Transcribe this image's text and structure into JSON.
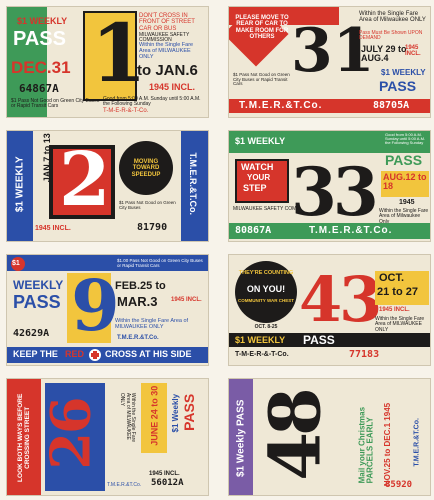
{
  "colors": {
    "red": "#d6352b",
    "yellow": "#f2c53d",
    "blue": "#2b4fa8",
    "green": "#3e9a58",
    "black": "#1d1b1a",
    "orange": "#e07a2f",
    "purple": "#7a5ca6",
    "cream": "#efe8d6",
    "teal": "#2f8f8a"
  },
  "passes": [
    {
      "number": "1",
      "kicker": "$1 WEEKLY",
      "title": "PASS",
      "warn": "DON'T CROSS IN FRONT OF STREET CAR OR BUS",
      "safety": "MILWAUKEE SAFETY COMMISSION",
      "area": "Within the Single Fare Area of MILWAUKEE ONLY",
      "from": "DEC.31",
      "to": "to JAN.6",
      "year": "1945 INCL.",
      "serial": "64867A",
      "note": "$1 Pass Not Good on Green City Buses or Rapid Transit Cars",
      "good": "Good from 5:00 A.M. Sunday until 5:00 A.M. the Following Sunday",
      "company": "T-M-E-R-&-T-Co."
    },
    {
      "number": "31",
      "banner": "PLEASE MOVE TO REAR OF CAR TO MAKE ROOM FOR OTHERS",
      "area": "Within the Single Fare Area of Milwaukee ONLY",
      "demand": "Pass Must Be Shown UPON DEMAND",
      "dates": "JULY 29 to AUG.4",
      "year": "1945 INCL.",
      "kicker": "$1 WEEKLY",
      "title": "PASS",
      "company": "T.M.E.R.&T.Co.",
      "serial": "88705A",
      "note": "$1 Pass Not Good on Green City Buses or Rapid Transit Cars"
    },
    {
      "number": "2",
      "dates": "JAN.7 to 13",
      "year": "1945 INCL.",
      "kicker": "$1 WEEKLY",
      "title": "PASS",
      "side": "MOVING TOWARD SPEEDUP",
      "company": "T.M.E.R.&T.Co.",
      "serial": "81790",
      "note": "$1 Pass Not Good on Green City Buses"
    },
    {
      "number": "33",
      "kicker": "$1 WEEKLY",
      "title": "PASS",
      "badge1": "WATCH",
      "badge2": "YOUR",
      "badge3": "STEP",
      "safety": "MILWAUKEE SAFETY COM.",
      "dates": "AUG.12 to 18",
      "year": "1945",
      "area": "Within the Single Fare Area of Milwaukee Only",
      "company": "T.M.E.R.&T.Co.",
      "serial": "80867A",
      "good": "Good from 5:00 A.M. Sunday until 5:00 A.M. the Following Sunday"
    },
    {
      "number": "9",
      "kicker": "$1",
      "title1": "WEEKLY",
      "title2": "PASS",
      "dates1": "FEB.25 to",
      "dates2": "MAR.3",
      "year": "1945 INCL.",
      "note": "$1.00 Pass Not Good on Green City Buses or Rapid Transit Cars",
      "area": "Within the Single Fare Area of MILWAUKEE ONLY",
      "serial": "42629A",
      "footer1": "KEEP THE",
      "footer2": "RED",
      "footer3": "CROSS AT HIS SIDE",
      "company": "T.M.E.R.&T.Co."
    },
    {
      "number": "43",
      "ring1": "THEY'RE COUNTING",
      "ring2": "ON YOU!",
      "ring3": "COMMUNITY WAR CHEST",
      "ring4": "OCT. 8-25",
      "dates1": "OCT.",
      "dates2": "21 to 27",
      "year": "1945 INCL.",
      "area": "Within the Single Fare Area of MILWAUKEE ONLY",
      "kicker": "$1 WEEKLY",
      "title": "PASS",
      "company": "T-M-E-R-&-T-Co.",
      "serial": "77183"
    },
    {
      "number": "26",
      "slogan": "LOOK BOTH WAYS BEFORE CROSSING STREET",
      "dates": "JUNE 24 to 30",
      "year": "1945 INCL.",
      "kicker": "$1 Weekly",
      "title": "PASS",
      "serial": "56012A",
      "area": "Within the Single Fare Area of MILWAUKEE ONLY",
      "company": "T.M.E.R.&T.Co."
    },
    {
      "number": "48",
      "title": "$1 Weekly PASS",
      "mail": "Mail your Christmas PARCELS EARLY",
      "dates": "NOV.25 to DEC.1 1945",
      "company": "T.M.E.R.&T.Co.",
      "serial": "85920"
    }
  ]
}
